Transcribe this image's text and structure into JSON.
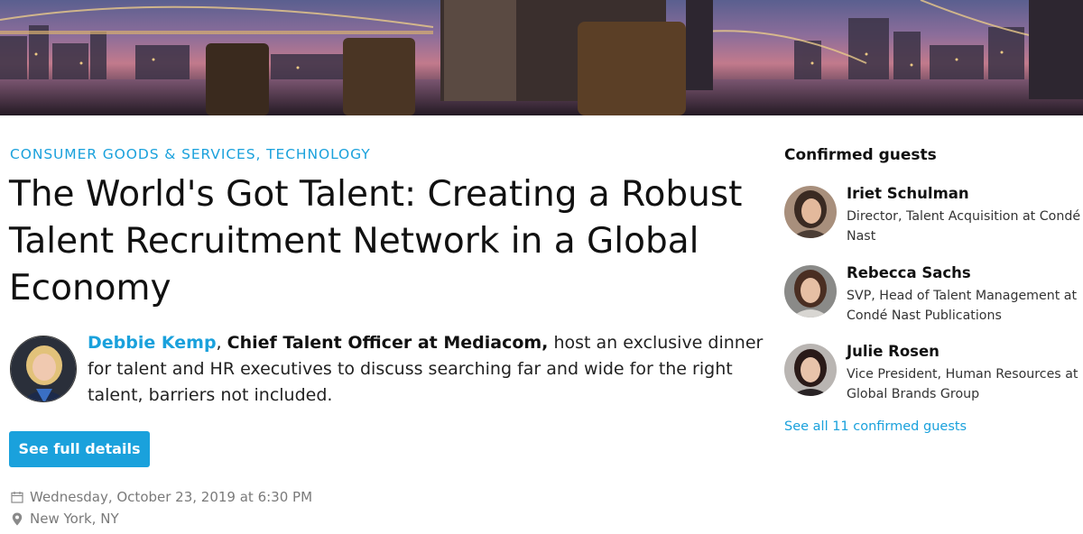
{
  "event": {
    "category": "CONSUMER GOODS & SERVICES, TECHNOLOGY",
    "title": "The World's Got Talent: Creating a Robust Talent Recruitment Network in a Global Economy",
    "host": {
      "name": "Debbie Kemp",
      "separator": ",",
      "role": "Chief Talent Officer at Mediacom,",
      "description": "host an exclusive dinner for talent and HR executives to discuss searching far and wide for the right talent, barriers not included."
    },
    "details_button": "See full details",
    "date": "Wednesday, October 23, 2019 at 6:30 PM",
    "location": "New York, NY"
  },
  "guests": {
    "heading": "Confirmed guests",
    "items": [
      {
        "name": "Iriet Schulman",
        "title": "Director, Talent Acquisition at Condé Nast"
      },
      {
        "name": "Rebecca Sachs",
        "title": "SVP, Head of Talent Management at Condé Nast Publications"
      },
      {
        "name": "Julie Rosen",
        "title": "Vice President, Human Resources at Global Brands Group"
      }
    ],
    "see_all": "See all 11 confirmed guests"
  },
  "icons": {
    "date": "calendar-icon",
    "location": "map-pin-icon"
  },
  "colors": {
    "accent": "#1aa1dc",
    "text": "#111111",
    "muted": "#7a7a7a"
  }
}
